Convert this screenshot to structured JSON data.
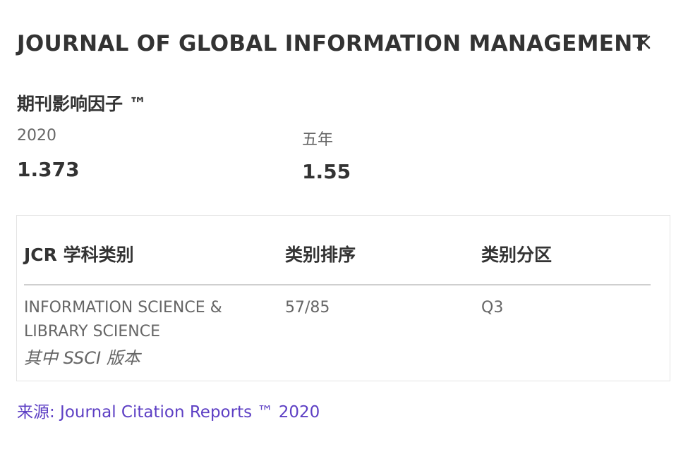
{
  "header": {
    "title": "JOURNAL OF GLOBAL INFORMATION MANAGEMENT",
    "close_icon": "close-icon"
  },
  "impact_factor": {
    "title": "期刊影响因子 ™",
    "current": {
      "label": "2020",
      "value": "1.373"
    },
    "five_year": {
      "label": "五年",
      "value": "1.55"
    }
  },
  "jcr_table": {
    "headers": [
      "JCR 学科类别",
      "类别排序",
      "类别分区"
    ],
    "rows": [
      {
        "category": "INFORMATION SCIENCE & LIBRARY SCIENCE",
        "edition": "其中 SSCI 版本",
        "rank": "57/85",
        "quartile": "Q3"
      }
    ],
    "colors": {
      "border": "#e4e4e4",
      "divider": "#cfcfcf"
    }
  },
  "source": {
    "text": "来源: Journal Citation Reports ™ 2020",
    "color": "#5d3fc4"
  }
}
